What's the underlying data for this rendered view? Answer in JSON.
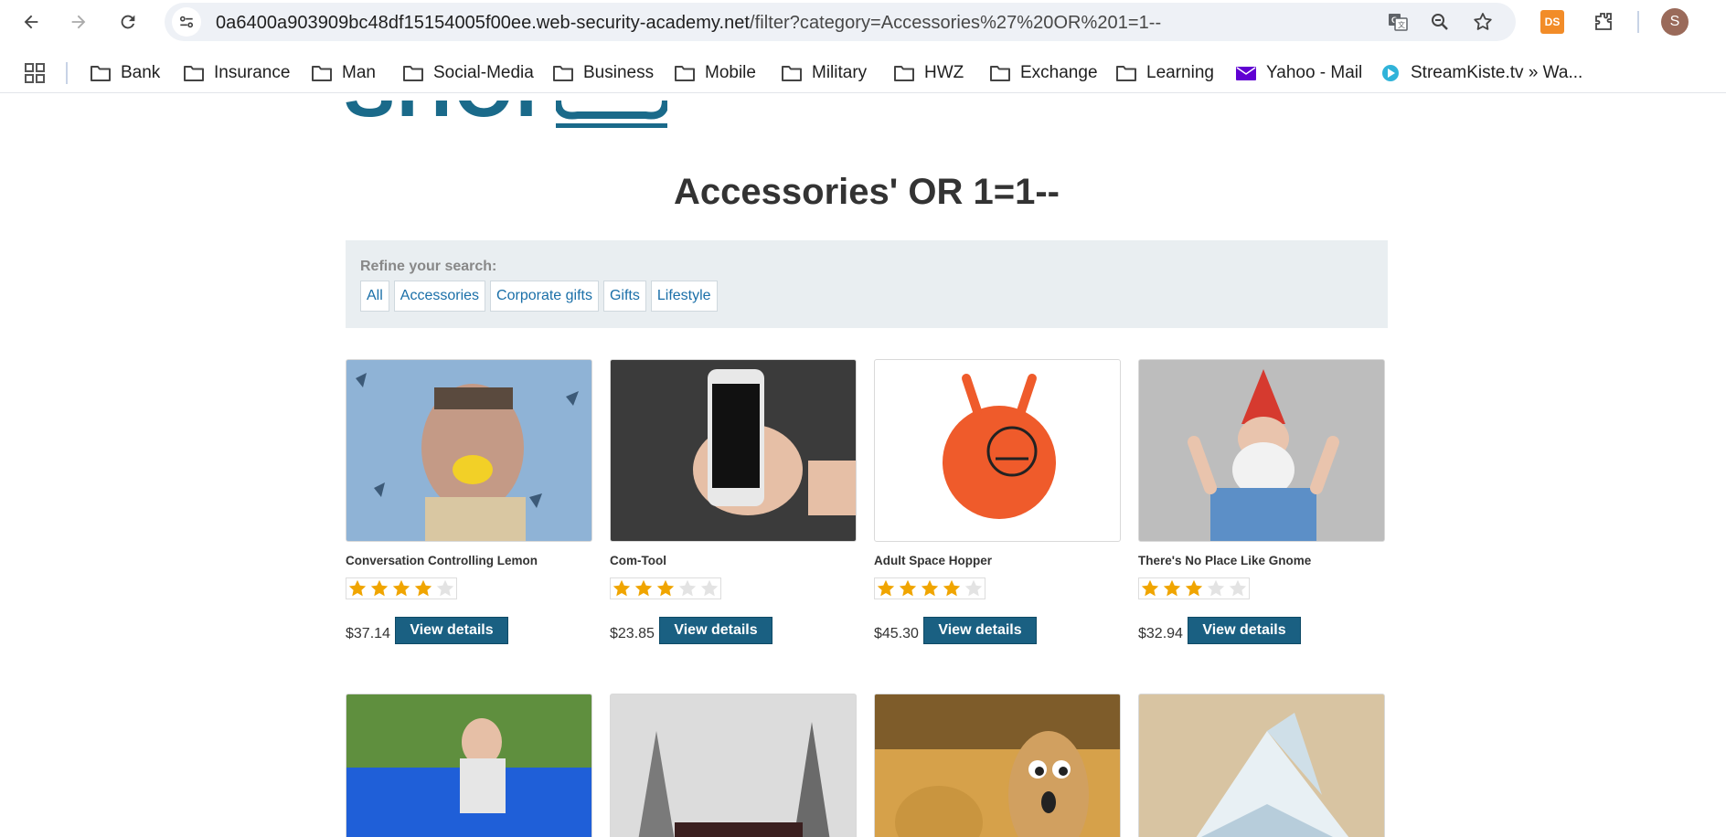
{
  "browser": {
    "url_host": "0a6400a903909bc48df15154005f00ee.web-security-academy.net",
    "url_path": "/filter?category=Accessories%27%20OR%201=1--",
    "extension_label": "DS",
    "profile_initial": "S",
    "icons": [
      "back-icon",
      "forward-icon",
      "reload-icon",
      "site-info-icon",
      "translate-icon",
      "zoom-icon",
      "bookmark-star-icon",
      "extensions-icon"
    ]
  },
  "bookmarks": [
    {
      "label": "Bank",
      "icon": "folder-icon"
    },
    {
      "label": "Insurance",
      "icon": "folder-icon"
    },
    {
      "label": "Man",
      "icon": "folder-icon"
    },
    {
      "label": "Social-Media",
      "icon": "folder-icon"
    },
    {
      "label": "Business",
      "icon": "folder-icon"
    },
    {
      "label": "Mobile",
      "icon": "folder-icon"
    },
    {
      "label": "Military",
      "icon": "folder-icon"
    },
    {
      "label": "HWZ",
      "icon": "folder-icon"
    },
    {
      "label": "Exchange",
      "icon": "folder-icon"
    },
    {
      "label": "Learning",
      "icon": "folder-icon"
    },
    {
      "label": "Yahoo - Mail",
      "icon": "yahoo-mail-icon"
    },
    {
      "label": "StreamKiste.tv » Wa...",
      "icon": "streamkiste-icon"
    }
  ],
  "page": {
    "logo": "SHOP",
    "title": "Accessories' OR 1=1--",
    "refine_label": "Refine your search:",
    "filters": [
      "All",
      "Accessories",
      "Corporate gifts",
      "Gifts",
      "Lifestyle"
    ],
    "view_details_label": "View details",
    "products": [
      {
        "name": "Conversation Controlling Lemon",
        "price": "$37.14",
        "rating": 4,
        "image": "man-with-lemon-image"
      },
      {
        "name": "Com-Tool",
        "price": "$23.85",
        "rating": 3,
        "image": "hand-holding-phone-image"
      },
      {
        "name": "Adult Space Hopper",
        "price": "$45.30",
        "rating": 4,
        "image": "orange-space-hopper-image"
      },
      {
        "name": "There's No Place Like Gnome",
        "price": "$32.94",
        "rating": 3,
        "image": "man-dressed-as-gnome-image"
      },
      {
        "name": "",
        "price": "",
        "rating": 0,
        "image": "girl-on-beanbag-image"
      },
      {
        "name": "",
        "price": "",
        "rating": 0,
        "image": "snowy-train-image"
      },
      {
        "name": "",
        "price": "",
        "rating": 0,
        "image": "potato-faces-image"
      },
      {
        "name": "",
        "price": "",
        "rating": 0,
        "image": "paper-origami-image"
      }
    ]
  },
  "colors": {
    "accent": "#1a6082",
    "link": "#1a6fa8",
    "star_filled": "#f0a500",
    "star_empty": "#e3e3e3",
    "refine_bg": "#e9eef1"
  }
}
